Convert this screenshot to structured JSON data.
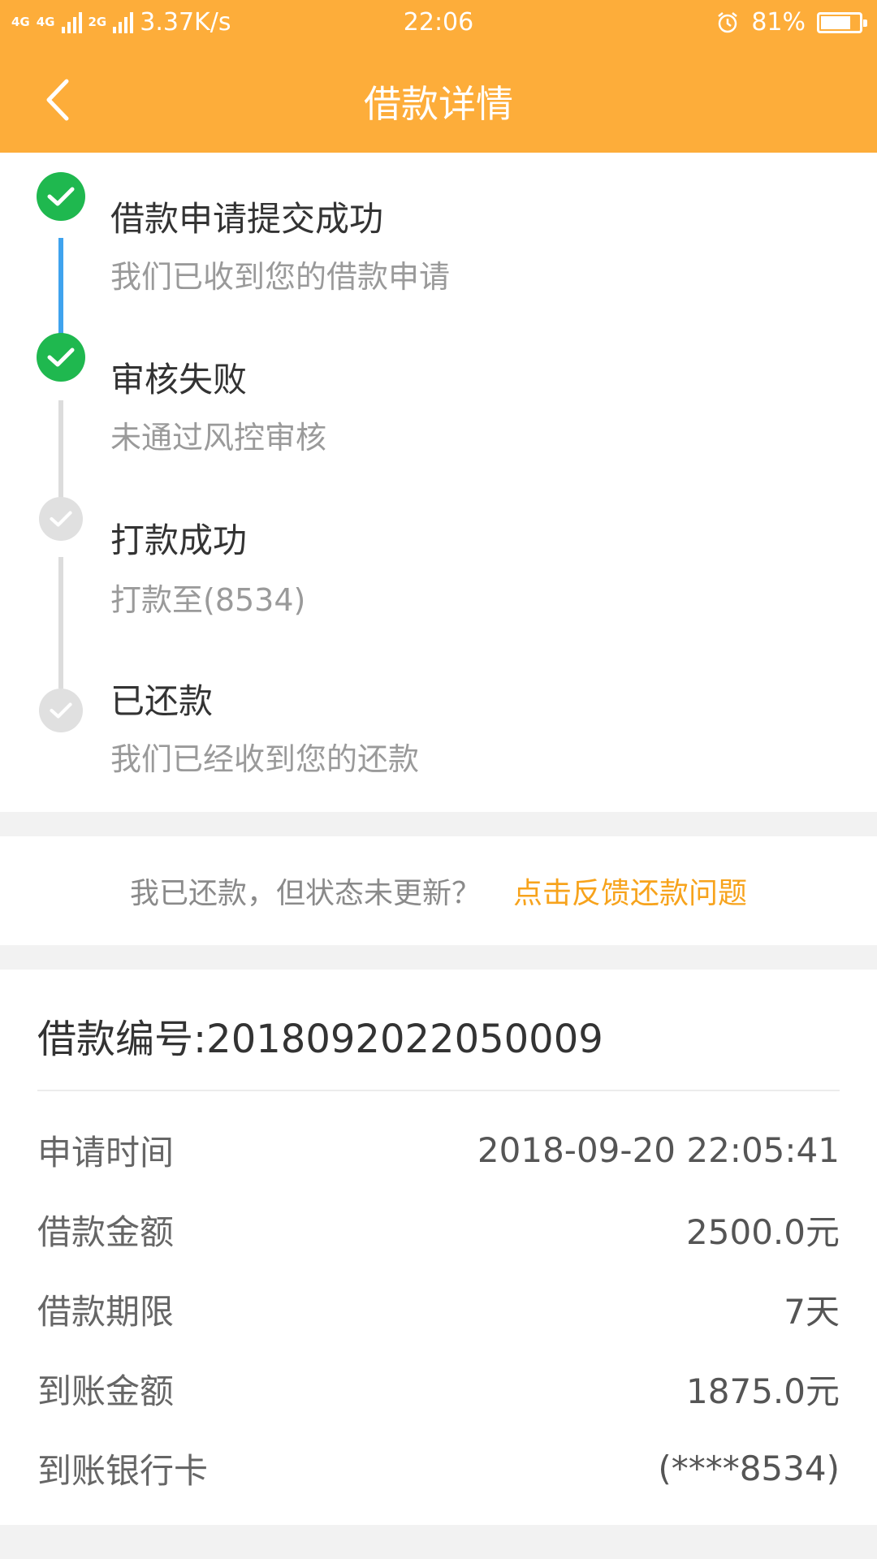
{
  "status_bar": {
    "network_1": "4G",
    "network_2": "4G",
    "network_3": "2G",
    "speed": "3.37K/s",
    "time": "22:06",
    "battery": "81%",
    "battery_level": 0.81
  },
  "nav": {
    "title": "借款详情",
    "back_icon": "chevron-left-icon"
  },
  "colors": {
    "header": "#fdad3a",
    "done": "#1fb84f",
    "pending": "#e0e0e0",
    "progress_line": "#3fa3ee",
    "link": "#f7a31c"
  },
  "timeline": [
    {
      "title": "借款申请提交成功",
      "desc": "我们已收到您的借款申请",
      "state": "done",
      "icon": "check-circle-icon"
    },
    {
      "title": "审核失败",
      "desc": "未通过风控审核",
      "state": "done",
      "icon": "check-circle-icon"
    },
    {
      "title": "打款成功",
      "desc": "打款至(8534)",
      "state": "pending",
      "icon": "check-circle-icon"
    },
    {
      "title": "已还款",
      "desc": "我们已经收到您的还款",
      "state": "pending",
      "icon": "check-circle-icon"
    }
  ],
  "feedback": {
    "question": "我已还款，但状态未更新？",
    "link": "点击反馈还款问题"
  },
  "detail": {
    "loan_number": "借款编号:2018092022050009",
    "rows": [
      {
        "label": "申请时间",
        "value": "2018-09-20 22:05:41"
      },
      {
        "label": "借款金额",
        "value": "2500.0元"
      },
      {
        "label": "借款期限",
        "value": "7天"
      },
      {
        "label": "到账金额",
        "value": "1875.0元"
      },
      {
        "label": "到账银行卡",
        "value": "(****8534)"
      }
    ]
  }
}
